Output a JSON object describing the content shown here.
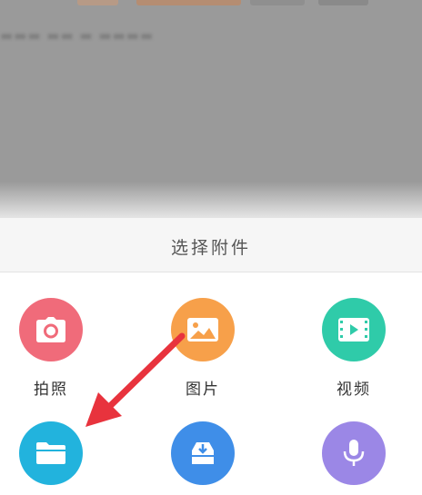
{
  "dialog": {
    "title": "选择附件"
  },
  "options": [
    {
      "label": "拍照",
      "icon": "camera-icon",
      "color": "#f06b7a"
    },
    {
      "label": "图片",
      "icon": "image-icon",
      "color": "#f7a04a"
    },
    {
      "label": "视频",
      "icon": "video-icon",
      "color": "#2fcba9"
    },
    {
      "label": "",
      "icon": "folder-icon",
      "color": "#22b3dd"
    },
    {
      "label": "",
      "icon": "download-icon",
      "color": "#3f8ee8"
    },
    {
      "label": "",
      "icon": "microphone-icon",
      "color": "#9b87e6"
    }
  ],
  "annotation": {
    "arrow_color": "#e8333d"
  }
}
